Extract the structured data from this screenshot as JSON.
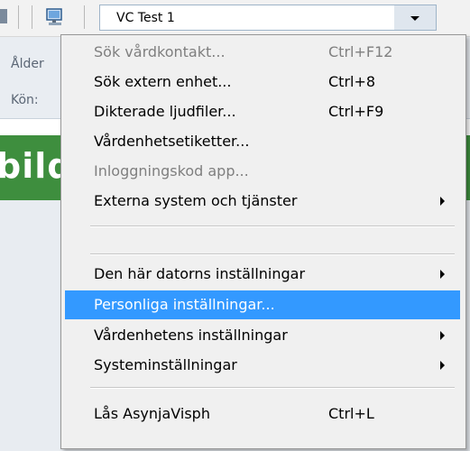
{
  "toolbar": {
    "combo_value": "VC Test 1",
    "combo_arrow_icon": "chevron-down-icon",
    "monitor_icon": "computer-monitor-icon"
  },
  "info": {
    "age_label": "Ålder",
    "gender_label": "Kön: "
  },
  "banner": {
    "text": "bild"
  },
  "menu": {
    "items": [
      {
        "label": "Sök vårdkontakt...",
        "shortcut": "Ctrl+F12",
        "disabled": true
      },
      {
        "label": "Sök extern enhet...",
        "shortcut": "Ctrl+8",
        "disabled": false
      },
      {
        "label": "Dikterade ljudfiler...",
        "shortcut": "Ctrl+F9",
        "disabled": false
      },
      {
        "label": "Vårdenhetsetiketter...",
        "shortcut": "",
        "disabled": false
      },
      {
        "label": "Inloggningskod app...",
        "shortcut": "",
        "disabled": true
      },
      {
        "label": "Externa system och tjänster",
        "shortcut": "",
        "submenu": true
      },
      {
        "label": "Den här datorns inställningar",
        "shortcut": "",
        "submenu": true
      },
      {
        "label": "Personliga inställningar...",
        "shortcut": "",
        "selected": true
      },
      {
        "label": "Vårdenhetens inställningar",
        "shortcut": "",
        "submenu": true
      },
      {
        "label": "Systeminställningar",
        "shortcut": "",
        "submenu": true
      },
      {
        "label": "Lås AsynjaVisph",
        "shortcut": "Ctrl+L",
        "disabled": false
      }
    ]
  },
  "colors": {
    "selection": "#3399ff",
    "banner_green": "#3e8e3e",
    "disabled_text": "#7f7f7f"
  }
}
